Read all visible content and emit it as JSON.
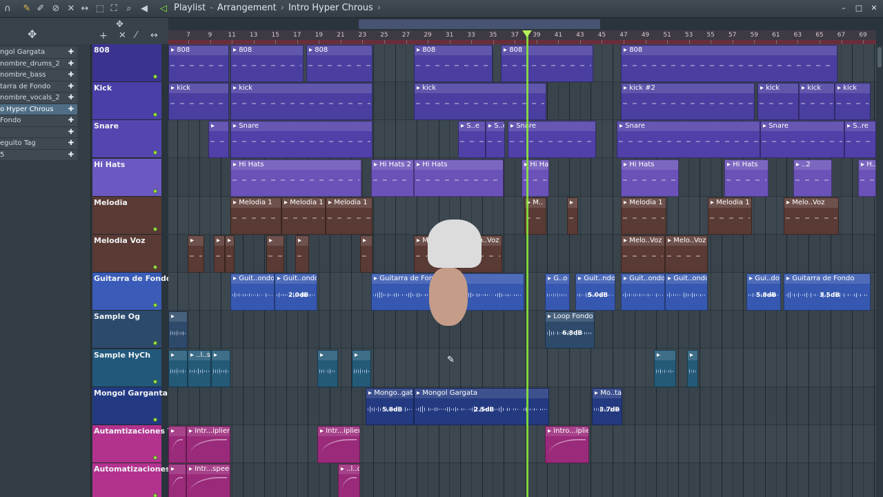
{
  "title_bar": {
    "window": "Playlist",
    "section": "Arrangement",
    "pattern": "Intro Hyper Chrous",
    "minimize": "–",
    "maximize": "□",
    "close": "✕"
  },
  "browser": {
    "items": [
      {
        "label": "ngol Gargata",
        "selected": false
      },
      {
        "label": "nombre_drums_2",
        "selected": false
      },
      {
        "label": "nombre_bass",
        "selected": false
      },
      {
        "label": "tarra de Fondo",
        "selected": false
      },
      {
        "label": "nombre_vocals_2",
        "selected": false
      },
      {
        "label": "o Hyper Chrous",
        "selected": true
      },
      {
        "label": "Fondo",
        "selected": false
      },
      {
        "label": "",
        "selected": false
      },
      {
        "label": "eguito Tag",
        "selected": false
      },
      {
        "label": "5",
        "selected": false
      }
    ]
  },
  "ruler": {
    "bars": [
      "7",
      "9",
      "11",
      "13",
      "15",
      "17",
      "19",
      "21",
      "23",
      "25",
      "27",
      "29",
      "31",
      "33",
      "35",
      "37",
      "39",
      "41",
      "43",
      "45",
      "47",
      "49",
      "51",
      "53",
      "55",
      "57",
      "59",
      "61",
      "63",
      "65",
      "67",
      "69"
    ]
  },
  "tracks": [
    {
      "name": "808",
      "color": "#4a3fa0",
      "clips": [
        [
          "808",
          0,
          88
        ],
        [
          "808",
          90,
          196
        ],
        [
          "808",
          200,
          296
        ],
        [
          "808",
          356,
          470
        ],
        [
          "808",
          482,
          616
        ],
        [
          "808",
          656,
          970
        ]
      ]
    },
    {
      "name": "Kick",
      "color": "#4a3fa0",
      "clips": [
        [
          "kick",
          0,
          88
        ],
        [
          "kick",
          90,
          296
        ],
        [
          "kick",
          356,
          548
        ],
        [
          "kick #2",
          656,
          850
        ],
        [
          "kick",
          854,
          914
        ],
        [
          "kick",
          914,
          966
        ],
        [
          "kick",
          966,
          1018
        ]
      ]
    },
    {
      "name": "Snare",
      "color": "#5040a8",
      "clips": [
        [
          "",
          58,
          88
        ],
        [
          "Snare",
          90,
          296
        ],
        [
          "S..e",
          420,
          460
        ],
        [
          "S..e",
          460,
          488
        ],
        [
          "Snare",
          492,
          620
        ],
        [
          "Snare",
          650,
          858
        ],
        [
          "Snare",
          858,
          980
        ],
        [
          "S..re",
          980,
          1026
        ]
      ]
    },
    {
      "name": "Hi Hats",
      "color": "#6a52b8",
      "clips": [
        [
          "Hi Hats",
          90,
          280
        ],
        [
          "Hi Hats 2",
          294,
          356
        ],
        [
          "Hi Hats",
          356,
          486
        ],
        [
          "Hi Hats",
          512,
          552
        ],
        [
          "Hi Hats",
          656,
          740
        ],
        [
          "Hi Hats",
          806,
          870
        ],
        [
          "..2",
          906,
          962
        ],
        [
          "H..s",
          1000,
          1026
        ]
      ]
    },
    {
      "name": "Melodia",
      "color": "#5a3a34",
      "clips": [
        [
          "Melodia 1",
          90,
          164
        ],
        [
          "Melodia 1",
          164,
          228
        ],
        [
          "Melodia 1",
          228,
          296
        ],
        [
          "M..",
          516,
          548
        ],
        [
          "",
          578,
          594
        ],
        [
          "Melodia 1",
          656,
          722
        ],
        [
          "Melodia 1",
          782,
          846
        ],
        [
          "Melo..Voz",
          892,
          972
        ]
      ]
    },
    {
      "name": "Melodia Voz",
      "color": "#5a3a34",
      "clips": [
        [
          "",
          28,
          52
        ],
        [
          "",
          66,
          82
        ],
        [
          "",
          82,
          96
        ],
        [
          "",
          142,
          168
        ],
        [
          "",
          184,
          204
        ],
        [
          "",
          278,
          296
        ],
        [
          "Melo..Voz",
          356,
          420
        ],
        [
          "Melo..Voz",
          420,
          484
        ],
        [
          "Melo..Voz",
          656,
          720
        ],
        [
          "Melo..Voz",
          720,
          782
        ]
      ]
    },
    {
      "name": "Guitarra de Fondo",
      "color": "#3658b0",
      "clips": [
        [
          "Guit..ondo",
          90,
          154,
          ""
        ],
        [
          "Guit..ondo",
          154,
          216,
          "2.0dB"
        ],
        [
          "Guitarra de Fondo",
          294,
          516,
          "3.0dB"
        ],
        [
          "G..o",
          546,
          582,
          ""
        ],
        [
          "Guit..ndo",
          590,
          648,
          "5.0dB"
        ],
        [
          "Guit..ondo",
          656,
          720,
          ""
        ],
        [
          "Guit..ondo",
          720,
          782,
          ""
        ],
        [
          "Gui..do",
          838,
          888,
          "5.8dB"
        ],
        [
          "Guitarra de Fondo",
          892,
          1018,
          "3.5dB"
        ]
      ]
    },
    {
      "name": "Sample Og",
      "color": "#2e4a6a",
      "clips": [
        [
          "",
          0,
          28,
          ""
        ],
        [
          "Loop Fondo",
          546,
          618,
          "6.8dB"
        ]
      ]
    },
    {
      "name": "Sample HyCh",
      "color": "#245a78",
      "clips": [
        [
          "",
          0,
          28,
          ""
        ],
        [
          "..l..s",
          28,
          62,
          ""
        ],
        [
          "",
          62,
          90,
          ""
        ],
        [
          "",
          216,
          246,
          ""
        ],
        [
          "",
          266,
          294,
          ""
        ],
        [
          "",
          704,
          736,
          ""
        ],
        [
          "",
          752,
          768,
          ""
        ]
      ]
    },
    {
      "name": "Mongol Garganta",
      "color": "#243a80",
      "clips": [
        [
          "Mongo..gata",
          286,
          356,
          "5.8dB"
        ],
        [
          "Mongol Gargata",
          356,
          552,
          "2.5dB"
        ],
        [
          "Mo..ta",
          614,
          658,
          "3.7dB"
        ]
      ]
    },
    {
      "name": "Autamtizaciones Vol",
      "color": "#9a2a7a",
      "clips": [
        [
          "",
          0,
          26
        ],
        [
          "Intr...iplier",
          26,
          90
        ],
        [
          "Intr...iplier",
          216,
          278
        ],
        [
          "Intro...iplier",
          546,
          610
        ]
      ]
    },
    {
      "name": "Automatizaciones",
      "color": "#9a2a7a",
      "clips": [
        [
          "",
          0,
          26
        ],
        [
          "Intr...speed",
          26,
          90
        ],
        [
          "..l..d",
          246,
          278
        ]
      ]
    }
  ],
  "colors": {
    "playhead": "#8df03a",
    "header_808": "#3d3488",
    "header_pink": "#c03a9a"
  }
}
